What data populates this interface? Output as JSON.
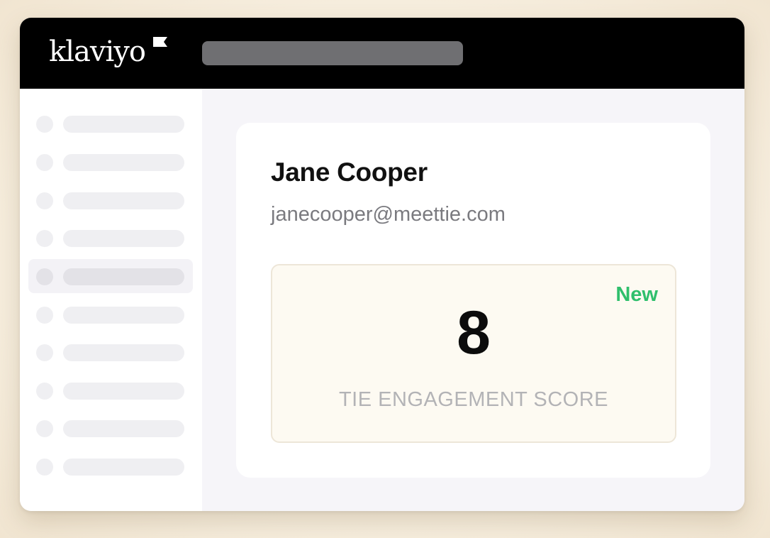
{
  "app": {
    "logo_text": "klaviyo"
  },
  "sidebar": {
    "item_count": 10,
    "active_index": 4
  },
  "profile": {
    "name": "Jane Cooper",
    "email": "janecooper@meettie.com"
  },
  "score_card": {
    "badge": "New",
    "value": "8",
    "label": "TIE ENGAGEMENT SCORE"
  },
  "colors": {
    "topbar": "#000000",
    "badge_green": "#2fbf6c",
    "score_box_bg": "#fdfaf2"
  }
}
